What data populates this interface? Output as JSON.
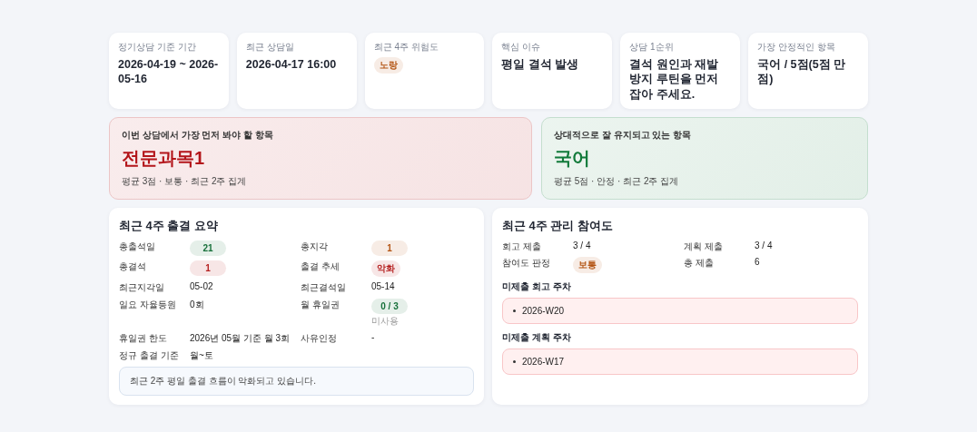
{
  "summary_cards": [
    {
      "label": "정기상담 기준 기간",
      "kind": "text",
      "value": "2026-04-19 ~ 2026-05-16"
    },
    {
      "label": "최근 상담일",
      "kind": "text",
      "value": "2026-04-17 16:00"
    },
    {
      "label": "최근 4주 위험도",
      "kind": "badge",
      "color": "#b35413",
      "value": "노랑"
    },
    {
      "label": "핵심 이슈",
      "kind": "text",
      "value": "평일 결석 발생"
    },
    {
      "label": "상담 1순위",
      "kind": "text",
      "value": "결석 원인과 재발 방지 루틴을 먼저 잡아 주세요."
    },
    {
      "label": "가장 안정적인 항목",
      "kind": "text",
      "value": "국어 / 5점(5점 만점)"
    }
  ],
  "focus_cards": [
    {
      "label": "이번 상담에서 가장 먼저 봐야 할 항목",
      "title": "전문과목1",
      "detail": "평균 3점 · 보통 · 최근 2주 집계",
      "color": "#b3151a"
    },
    {
      "label": "상대적으로 잘 유지되고 있는 항목",
      "title": "국어",
      "detail": "평균 5점 · 안정 · 최근 2주 집계",
      "color": "#117a3a"
    }
  ],
  "attendance": {
    "title": "최근 4주 출결 요약",
    "items": [
      {
        "label": "총출석일",
        "kind": "badge",
        "color": "#17703a",
        "value": "21"
      },
      {
        "label": "총지각",
        "kind": "badge",
        "color": "#b35413",
        "value": "1"
      },
      {
        "label": "총결석",
        "kind": "badge",
        "color": "#b52020",
        "value": "1"
      },
      {
        "label": "출결 추세",
        "kind": "pill",
        "color": "#b52020",
        "value": "악화"
      },
      {
        "label": "최근지각일",
        "kind": "text",
        "value": "05-02"
      },
      {
        "label": "최근결석일",
        "kind": "text",
        "value": "05-14"
      },
      {
        "label": "일요 자율등원",
        "kind": "text",
        "value": "0회"
      },
      {
        "label": "월 휴일권",
        "kind": "badge",
        "color": "#17703a",
        "value": "0 / 3",
        "note": "미사용"
      },
      {
        "label": "휴일권 한도",
        "kind": "text",
        "value": "2026년 05월 기준 월 3회"
      },
      {
        "label": "사유인정",
        "kind": "text",
        "value": "-"
      },
      {
        "label": "정규 출결 기준",
        "kind": "text",
        "value": "월~토"
      }
    ],
    "message": "최근 2주 평일 출결 흐름이 악화되고 있습니다."
  },
  "participation": {
    "title": "최근 4주 관리 참여도",
    "items": [
      {
        "label": "회고 제출",
        "kind": "text",
        "value": "3 / 4"
      },
      {
        "label": "계획 제출",
        "kind": "text",
        "value": "3 / 4"
      },
      {
        "label": "참여도 판정",
        "kind": "pill",
        "color": "#b35413",
        "value": "보통"
      },
      {
        "label": "총 제출",
        "kind": "text",
        "value": "6"
      }
    ],
    "sections": [
      {
        "heading": "미제출 회고 주차",
        "weeks": [
          "2026-W20"
        ]
      },
      {
        "heading": "미제출 계획 주차",
        "weeks": [
          "2026-W17"
        ]
      }
    ]
  }
}
